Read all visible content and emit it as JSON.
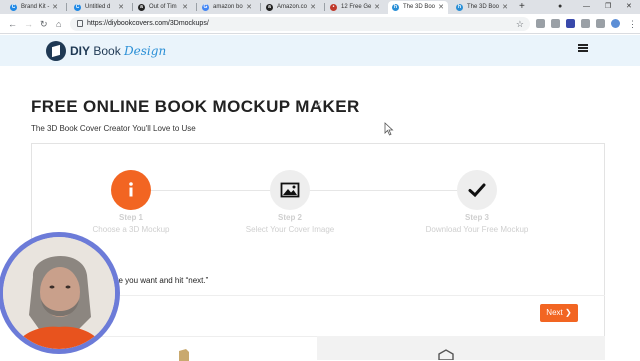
{
  "browser": {
    "tabs": [
      {
        "label": "Brand Kit -",
        "icon": "canva-icon",
        "color": "#1e88e5",
        "active": false
      },
      {
        "label": "Untitled d",
        "icon": "canva-icon",
        "color": "#1e88e5",
        "active": false
      },
      {
        "label": "Out of Tim",
        "icon": "amazon-icon",
        "color": "#222222",
        "active": false
      },
      {
        "label": "amazon bo",
        "icon": "google-icon",
        "color": "#4285f4",
        "active": false
      },
      {
        "label": "Amazon.co",
        "icon": "amazon-icon",
        "color": "#222222",
        "active": false
      },
      {
        "label": "12 Free Ge",
        "icon": "site-icon",
        "color": "#c0392b",
        "active": false
      },
      {
        "label": "The 3D Boo",
        "icon": "h-icon",
        "color": "#2a8fd6",
        "active": true
      },
      {
        "label": "The 3D Boo",
        "icon": "h-icon",
        "color": "#2a8fd6",
        "active": false
      }
    ],
    "new_tab": "+",
    "url": "https://diybookcovers.com/3Dmockups/"
  },
  "site": {
    "logo_bold": "DIY",
    "logo_regular": " Book ",
    "logo_script": "Design"
  },
  "page": {
    "title": "FREE ONLINE BOOK MOCKUP MAKER",
    "subtitle": "The 3D Book Cover Creator You'll Love to Use",
    "steps": [
      {
        "title": "Step 1",
        "desc": "Choose a 3D Mockup",
        "icon": "info-icon",
        "active": true
      },
      {
        "title": "Step 2",
        "desc": "Select Your Cover Image",
        "icon": "image-icon",
        "active": false
      },
      {
        "title": "Step 3",
        "desc": "Download Your Free Mockup",
        "icon": "checkmark-icon",
        "active": false
      }
    ],
    "instruction": "late you want and hit “next.”",
    "next_label": "Next"
  },
  "colors": {
    "accent": "#f26522",
    "brand": "#1f3954",
    "header_bg": "#eaf4fb",
    "webcam_ring": "#6c7bd8"
  }
}
